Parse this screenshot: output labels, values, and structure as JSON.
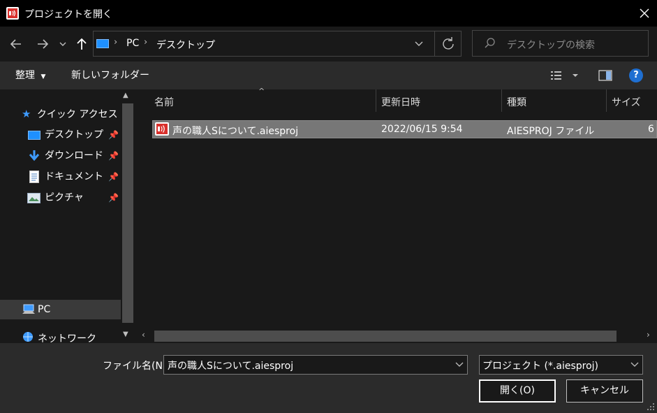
{
  "window": {
    "title": "プロジェクトを開く"
  },
  "address": {
    "crumbs": [
      "PC",
      "デスクトップ"
    ],
    "search_placeholder": "デスクトップの検索"
  },
  "toolbar": {
    "organize_label": "整理",
    "new_folder_label": "新しいフォルダー"
  },
  "nav": {
    "quick_access": "クイック アクセス",
    "items": [
      {
        "label": "デスクトップ",
        "icon": "desktop-icon",
        "pinned": true
      },
      {
        "label": "ダウンロード",
        "icon": "download-icon",
        "pinned": true
      },
      {
        "label": "ドキュメント",
        "icon": "document-icon",
        "pinned": true
      },
      {
        "label": "ピクチャ",
        "icon": "pictures-icon",
        "pinned": true
      }
    ],
    "pc": "PC",
    "network": "ネットワーク"
  },
  "columns": {
    "name": "名前",
    "modified": "更新日時",
    "type": "種類",
    "size": "サイズ"
  },
  "files": [
    {
      "name": "声の職人Sについて.aiesproj",
      "modified": "2022/06/15 9:54",
      "type": "AIESPROJ ファイル",
      "size": "6"
    }
  ],
  "footer": {
    "filename_label": "ファイル名(N):",
    "filename_value": "声の職人Sについて.aiesproj",
    "filetype_value": "プロジェクト (*.aiesproj)",
    "open_label": "開く(O)",
    "cancel_label": "キャンセル"
  },
  "colors": {
    "titlebar": "#000000",
    "background": "#191919",
    "toolbar": "#2b2b2b",
    "selection": "#777777",
    "accent": "#1e90ff",
    "app_icon": "#d9302c"
  }
}
